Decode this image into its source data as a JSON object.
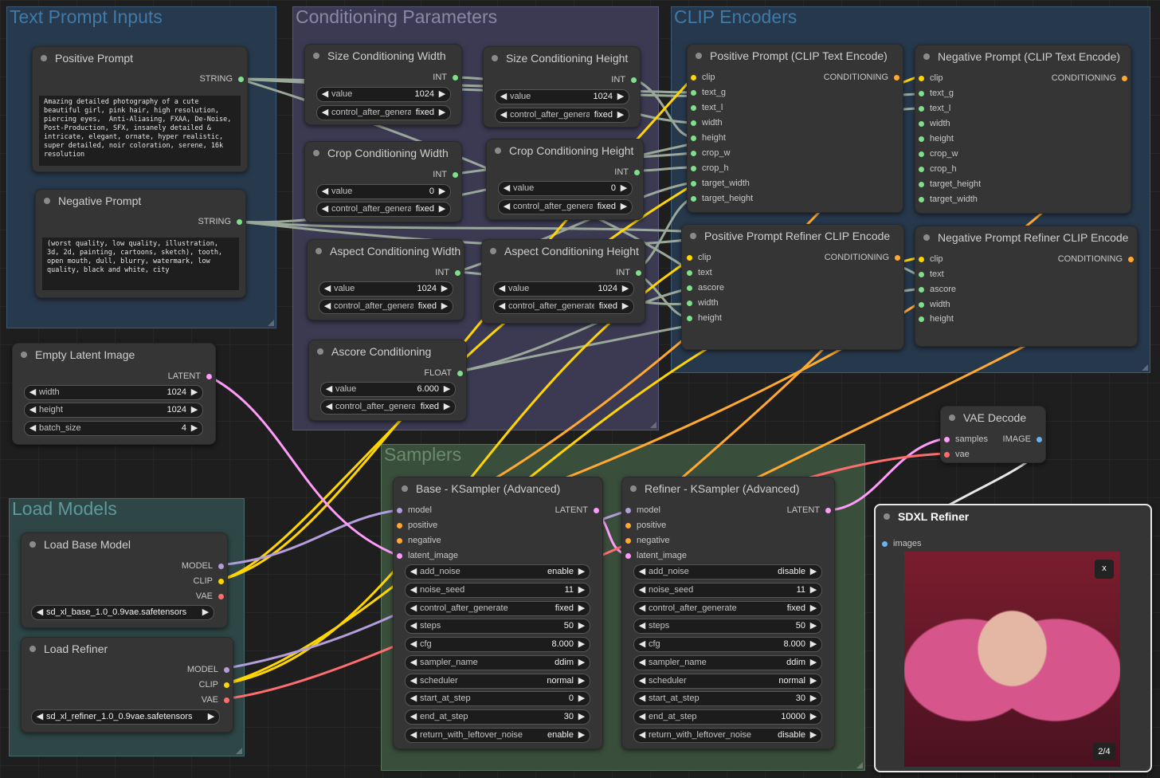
{
  "groups": {
    "text_prompt_inputs": "Text Prompt Inputs",
    "conditioning_parameters": "Conditioning Parameters",
    "clip_encoders": "CLIP Encoders",
    "load_models": "Load Models",
    "samplers": "Samplers"
  },
  "positive_prompt": {
    "title": "Positive Prompt",
    "output": "STRING",
    "text": "Amazing detailed photography of a cute beautiful girl, pink hair, high resolution, piercing eyes,  Anti-Aliasing, FXAA, De-Noise, Post-Production, SFX, insanely detailed & intricate, elegant, ornate, hyper realistic, super detailed, noir coloration, serene, 16k resolution"
  },
  "negative_prompt": {
    "title": "Negative Prompt",
    "output": "STRING",
    "text": "(worst quality, low quality, illustration, 3d, 2d, painting, cartoons, sketch), tooth, open mouth, dull, blurry, watermark, low quality, black and white, city"
  },
  "size_w": {
    "title": "Size Conditioning Width",
    "output": "INT",
    "value_label": "value",
    "value": "1024",
    "cag_label": "control_after_generate",
    "cag": "fixed"
  },
  "size_h": {
    "title": "Size Conditioning Height",
    "output": "INT",
    "value_label": "value",
    "value": "1024",
    "cag_label": "control_after_generate",
    "cag": "fixed"
  },
  "crop_w": {
    "title": "Crop Conditioning Width",
    "output": "INT",
    "value_label": "value",
    "value": "0",
    "cag_label": "control_after_generate",
    "cag": "fixed"
  },
  "crop_h": {
    "title": "Crop Conditioning Height",
    "output": "INT",
    "value_label": "value",
    "value": "0",
    "cag_label": "control_after_generate",
    "cag": "fixed"
  },
  "aspect_w": {
    "title": "Aspect Conditioning Width",
    "output": "INT",
    "value_label": "value",
    "value": "1024",
    "cag_label": "control_after_generate",
    "cag": "fixed"
  },
  "aspect_h": {
    "title": "Aspect Conditioning Height",
    "output": "INT",
    "value_label": "value",
    "value": "1024",
    "cag_label": "control_after_generate",
    "cag": "fixed"
  },
  "ascore": {
    "title": "Ascore Conditioning",
    "output": "FLOAT",
    "value_label": "value",
    "value": "6.000",
    "cag_label": "control_after_generate",
    "cag": "fixed"
  },
  "pos_clip": {
    "title": "Positive Prompt (CLIP Text Encode)",
    "output": "CONDITIONING",
    "inputs": [
      "clip",
      "text_g",
      "text_l",
      "width",
      "height",
      "crop_w",
      "crop_h",
      "target_width",
      "target_height"
    ]
  },
  "neg_clip": {
    "title": "Negative Prompt (CLIP Text Encode)",
    "output": "CONDITIONING",
    "inputs": [
      "clip",
      "text_g",
      "text_l",
      "width",
      "height",
      "crop_w",
      "crop_h",
      "target_height",
      "target_width"
    ]
  },
  "pos_ref": {
    "title": "Positive Prompt Refiner CLIP Encode",
    "output": "CONDITIONING",
    "inputs": [
      "clip",
      "text",
      "ascore",
      "width",
      "height"
    ]
  },
  "neg_ref": {
    "title": "Negative Prompt Refiner CLIP Encode",
    "output": "CONDITIONING",
    "inputs": [
      "clip",
      "text",
      "ascore",
      "width",
      "height"
    ]
  },
  "empty_latent": {
    "title": "Empty Latent Image",
    "output": "LATENT",
    "widgets": [
      {
        "label": "width",
        "value": "1024"
      },
      {
        "label": "height",
        "value": "1024"
      },
      {
        "label": "batch_size",
        "value": "4"
      }
    ]
  },
  "load_base": {
    "title": "Load Base Model",
    "outputs": [
      "MODEL",
      "CLIP",
      "VAE"
    ],
    "ckpt": "sd_xl_base_1.0_0.9vae.safetensors"
  },
  "load_refiner": {
    "title": "Load Refiner",
    "outputs": [
      "MODEL",
      "CLIP",
      "VAE"
    ],
    "ckpt": "sd_xl_refiner_1.0_0.9vae.safetensors"
  },
  "base_ks": {
    "title": "Base - KSampler (Advanced)",
    "output": "LATENT",
    "inputs": [
      "model",
      "positive",
      "negative",
      "latent_image"
    ],
    "widgets": [
      {
        "label": "add_noise",
        "value": "enable"
      },
      {
        "label": "noise_seed",
        "value": "11"
      },
      {
        "label": "control_after_generate",
        "value": "fixed"
      },
      {
        "label": "steps",
        "value": "50"
      },
      {
        "label": "cfg",
        "value": "8.000"
      },
      {
        "label": "sampler_name",
        "value": "ddim"
      },
      {
        "label": "scheduler",
        "value": "normal"
      },
      {
        "label": "start_at_step",
        "value": "0"
      },
      {
        "label": "end_at_step",
        "value": "30"
      },
      {
        "label": "return_with_leftover_noise",
        "value": "enable"
      }
    ]
  },
  "ref_ks": {
    "title": "Refiner - KSampler (Advanced)",
    "output": "LATENT",
    "inputs": [
      "model",
      "positive",
      "negative",
      "latent_image"
    ],
    "widgets": [
      {
        "label": "add_noise",
        "value": "disable"
      },
      {
        "label": "noise_seed",
        "value": "11"
      },
      {
        "label": "control_after_generate",
        "value": "fixed"
      },
      {
        "label": "steps",
        "value": "50"
      },
      {
        "label": "cfg",
        "value": "8.000"
      },
      {
        "label": "sampler_name",
        "value": "ddim"
      },
      {
        "label": "scheduler",
        "value": "normal"
      },
      {
        "label": "start_at_step",
        "value": "30"
      },
      {
        "label": "end_at_step",
        "value": "10000"
      },
      {
        "label": "return_with_leftover_noise",
        "value": "disable"
      }
    ]
  },
  "vae_decode": {
    "title": "VAE Decode",
    "inputs": [
      "samples",
      "vae"
    ],
    "output": "IMAGE"
  },
  "sdxl_refiner": {
    "title": "SDXL Refiner",
    "input": "images",
    "close": "x",
    "counter": "2/4"
  },
  "colors": {
    "clip": "#ffd500",
    "conditioning": "#ffa931",
    "latent": "#ff9cf9",
    "model": "#b39ddb",
    "vae": "#ff6e6e",
    "int": "#7ee08a",
    "image": "#64b5f6"
  }
}
